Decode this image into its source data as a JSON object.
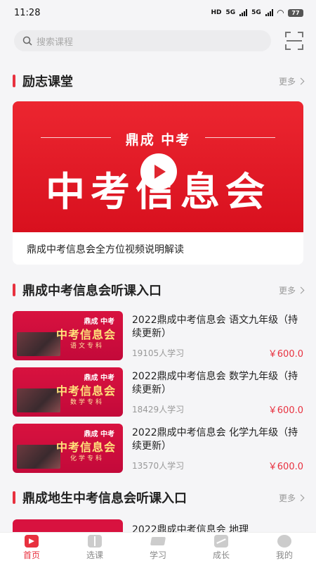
{
  "status_bar": {
    "time": "11:28",
    "network_left": "5G",
    "network_right": "5G",
    "battery": "77",
    "hd": "HD"
  },
  "search": {
    "placeholder": "搜索课程"
  },
  "section1": {
    "title": "励志课堂",
    "more": "更多"
  },
  "featured": {
    "banner_brand": "鼎成 中考",
    "banner_title": "中考信息会",
    "caption": "鼎成中考信息会全方位视频说明解读"
  },
  "section2": {
    "title": "鼎成中考信息会听课入口",
    "more": "更多",
    "courses": [
      {
        "title": "2022鼎成中考信息会 语文九年级（持续更新）",
        "learners": "19105人学习",
        "price": "￥600.0",
        "thumb_brand": "鼎成 中考",
        "thumb_title": "中考信息会",
        "thumb_subject": "语文专科"
      },
      {
        "title": "2022鼎成中考信息会 数学九年级（持续更新）",
        "learners": "18429人学习",
        "price": "￥600.0",
        "thumb_brand": "鼎成 中考",
        "thumb_title": "中考信息会",
        "thumb_subject": "数学专科"
      },
      {
        "title": "2022鼎成中考信息会 化学九年级（持续更新）",
        "learners": "13570人学习",
        "price": "￥600.0",
        "thumb_brand": "鼎成 中考",
        "thumb_title": "中考信息会",
        "thumb_subject": "化学专科"
      }
    ]
  },
  "section3": {
    "title": "鼎成地生中考信息会听课入口",
    "more": "更多",
    "partial_course_title": "2022鼎成中考信息会 地理"
  },
  "tabbar": {
    "items": [
      {
        "label": "首页",
        "icon": "home-icon",
        "active": true
      },
      {
        "label": "选课",
        "icon": "book-icon",
        "active": false
      },
      {
        "label": "学习",
        "icon": "graduation-cap-icon",
        "active": false
      },
      {
        "label": "成长",
        "icon": "trend-icon",
        "active": false
      },
      {
        "label": "我的",
        "icon": "profile-icon",
        "active": false
      }
    ]
  },
  "colors": {
    "accent": "#e8313f",
    "banner": "#e02630",
    "background": "#f5f5f7"
  }
}
